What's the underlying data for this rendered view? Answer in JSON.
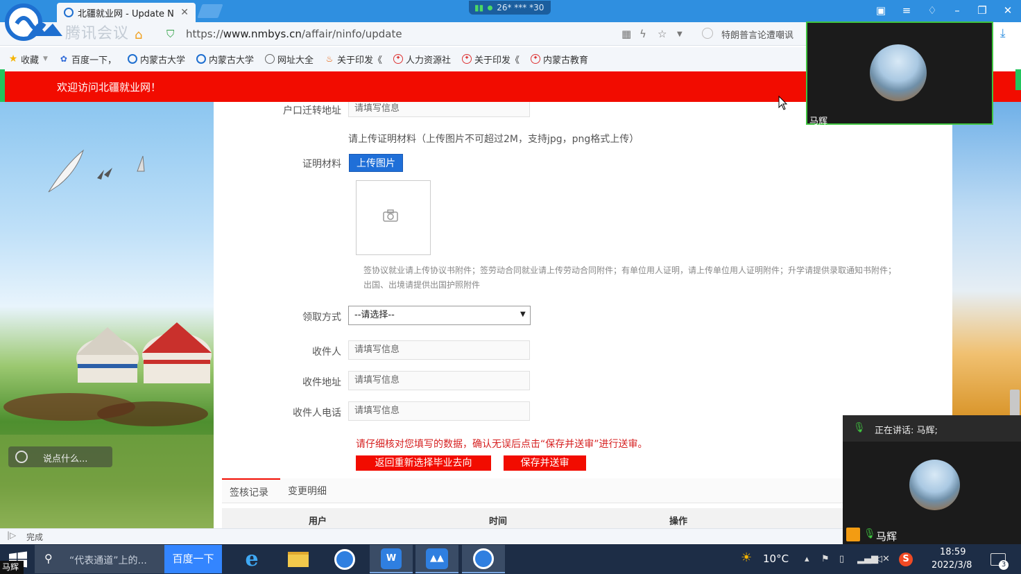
{
  "browser": {
    "tab_title": "北疆就业网 - Update N",
    "tab_close": "✕",
    "signal_text": "26* *** *30",
    "url_scheme": "https://",
    "url_host": "www.nmbys.cn",
    "url_path": "/affair/ninfo/update",
    "hot_news": "特朗普言论遭嘲讽",
    "watermark": "腾讯会议",
    "bookmarks": [
      {
        "label": "收藏",
        "icon": "star-icon"
      },
      {
        "label": "百度一下，",
        "icon": "baidu-paw-icon"
      },
      {
        "label": "内蒙古大学",
        "icon": "sogou-s-icon"
      },
      {
        "label": "内蒙古大学",
        "icon": "sogou-s-icon"
      },
      {
        "label": "网址大全",
        "icon": "globe-icon"
      },
      {
        "label": "关于印发《",
        "icon": "fire-icon"
      },
      {
        "label": "人力资源社",
        "icon": "government-emblem-icon"
      },
      {
        "label": "关于印发《",
        "icon": "government-emblem-icon"
      },
      {
        "label": "内蒙古教育",
        "icon": "government-emblem-icon"
      }
    ],
    "status_text": "完成"
  },
  "site": {
    "welcome": "欢迎访问北疆就业网！",
    "chat_placeholder": "说点什么..."
  },
  "form": {
    "hukou_label": "户口迁转地址",
    "hukou_placeholder": "请填写信息",
    "upload_hint": "请上传证明材料（上传图片不可超过2M，支持jpg，png格式上传）",
    "proof_label": "证明材料",
    "upload_button": "上传图片",
    "attachment_note_line1": "签协议就业请上传协议书附件；签劳动合同就业请上传劳动合同附件；有单位用人证明，请上传单位用人证明附件；升学请提供录取通知书附件；",
    "attachment_note_line2": "出国、出境请提供出国护照附件",
    "pickup_label": "领取方式",
    "pickup_selected": "--请选择--",
    "recipient_label": "收件人",
    "recipient_placeholder": "请填写信息",
    "address_label": "收件地址",
    "address_placeholder": "请填写信息",
    "phone_label": "收件人电话",
    "phone_placeholder": "请填写信息",
    "warning": "请仔细核对您填写的数据，确认无误后点击“保存并送审”进行送审。",
    "back_button": "返回重新选择毕业去向",
    "save_button": "保存并送审"
  },
  "records": {
    "tabs": [
      "签核记录",
      "变更明细"
    ],
    "columns": [
      "用户",
      "时间",
      "操作"
    ]
  },
  "meeting": {
    "video_name_top": "马辉",
    "speaking_label": "正在讲话: 马辉;",
    "speaker_name": "马辉",
    "corner_name": "马辉"
  },
  "taskbar": {
    "search_text": "“代表通道”上的...",
    "baidu_button": "百度一下",
    "temperature": "10°C",
    "time": "18:59",
    "date": "2022/3/8",
    "notification_count": "3"
  },
  "colors": {
    "banner_red": "#f20c00",
    "titlebar_blue": "#2f8fe0",
    "upload_blue": "#1f6fd8",
    "meeting_green": "#3fc43f",
    "taskbar": "#1d2d46"
  }
}
